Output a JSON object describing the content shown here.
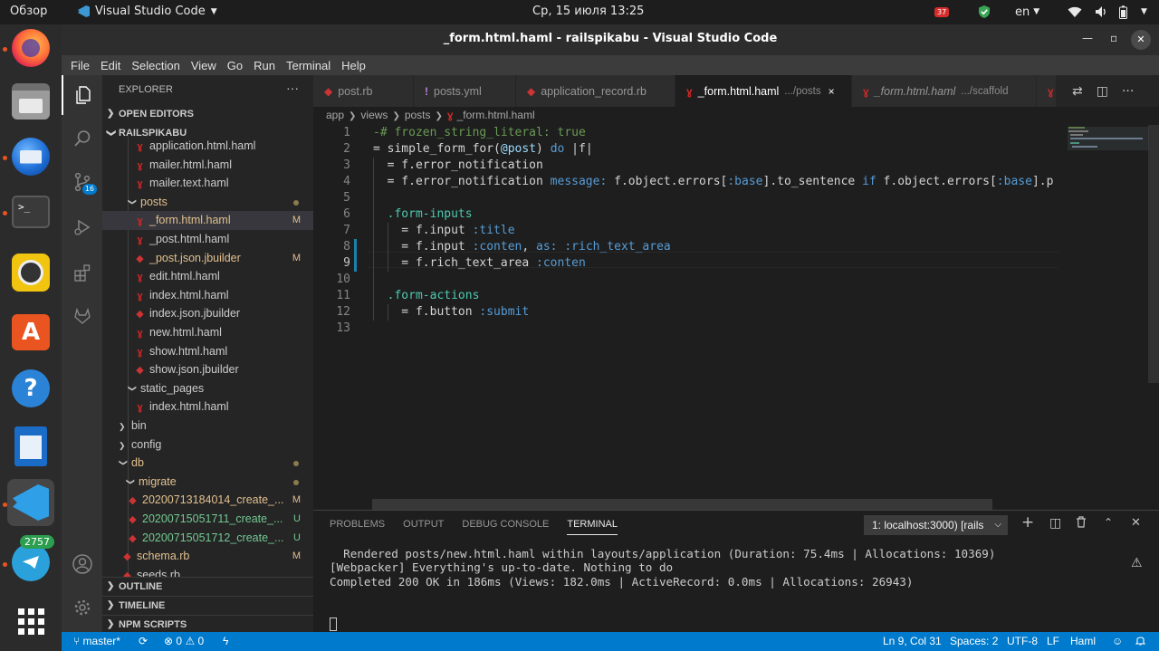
{
  "system_bar": {
    "activities": "Обзор",
    "app_name": "Visual Studio Code",
    "datetime": "Ср, 15 июля  13:25",
    "notification_count": "37",
    "keyboard_layout": "en"
  },
  "dock": {
    "telegram_badge": "2757",
    "apps": [
      "firefox-icon",
      "files-icon",
      "thunderbird-icon",
      "terminal-icon",
      "rhythmbox-icon",
      "software-center-icon",
      "help-icon",
      "libreoffice-writer-icon",
      "vscode-icon",
      "telegram-icon",
      "show-apps-icon"
    ]
  },
  "window": {
    "title": "_form.html.haml - railspikabu - Visual Studio Code"
  },
  "menu": [
    "File",
    "Edit",
    "Selection",
    "View",
    "Go",
    "Run",
    "Terminal",
    "Help"
  ],
  "activity": {
    "scm_badge": "16"
  },
  "explorer": {
    "header": "EXPLORER",
    "more": "···",
    "open_editors": "OPEN EDITORS",
    "project": "RAILSPIKABU",
    "tree": [
      {
        "name": "application.html.haml",
        "icon": "haml",
        "status": ""
      },
      {
        "name": "mailer.html.haml",
        "icon": "haml",
        "status": ""
      },
      {
        "name": "mailer.text.haml",
        "icon": "haml",
        "status": ""
      },
      {
        "name": "posts",
        "icon": "folder",
        "status": "dot"
      },
      {
        "name": "_form.html.haml",
        "icon": "haml",
        "status": "M"
      },
      {
        "name": "_post.html.haml",
        "icon": "haml",
        "status": ""
      },
      {
        "name": "_post.json.jbuilder",
        "icon": "rb",
        "status": "M"
      },
      {
        "name": "edit.html.haml",
        "icon": "haml",
        "status": ""
      },
      {
        "name": "index.html.haml",
        "icon": "haml",
        "status": ""
      },
      {
        "name": "index.json.jbuilder",
        "icon": "rb",
        "status": ""
      },
      {
        "name": "new.html.haml",
        "icon": "haml",
        "status": ""
      },
      {
        "name": "show.html.haml",
        "icon": "haml",
        "status": ""
      },
      {
        "name": "show.json.jbuilder",
        "icon": "rb",
        "status": ""
      },
      {
        "name": "static_pages",
        "icon": "folder",
        "status": ""
      },
      {
        "name": "index.html.haml",
        "icon": "haml",
        "status": ""
      },
      {
        "name": "bin",
        "icon": "folder-closed",
        "status": ""
      },
      {
        "name": "config",
        "icon": "folder-closed",
        "status": ""
      },
      {
        "name": "db",
        "icon": "folder",
        "status": "dot"
      },
      {
        "name": "migrate",
        "icon": "folder",
        "status": "dot"
      },
      {
        "name": "20200713184014_create_...",
        "icon": "rb",
        "status": "M"
      },
      {
        "name": "20200715051711_create_...",
        "icon": "rb",
        "status": "U"
      },
      {
        "name": "20200715051712_create_...",
        "icon": "rb",
        "status": "U"
      },
      {
        "name": "schema.rb",
        "icon": "rb",
        "status": "M"
      },
      {
        "name": "seeds.rb",
        "icon": "rb",
        "status": ""
      }
    ],
    "outline": "OUTLINE",
    "timeline": "TIMELINE",
    "npm_scripts": "NPM SCRIPTS"
  },
  "tabs": [
    {
      "icon": "rb",
      "name": "post.rb",
      "desc": ""
    },
    {
      "icon": "yml",
      "name": "posts.yml",
      "desc": ""
    },
    {
      "icon": "rb",
      "name": "application_record.rb",
      "desc": ""
    },
    {
      "icon": "haml",
      "name": "_form.html.haml",
      "desc": ".../posts"
    },
    {
      "icon": "haml",
      "name": "_form.html.haml",
      "desc": ".../scaffold"
    }
  ],
  "tab_close": "×",
  "breadcrumb": [
    "app",
    "views",
    "posts",
    "_form.html.haml"
  ],
  "code_line_numbers": [
    "1",
    "2",
    "3",
    "4",
    "5",
    "6",
    "7",
    "8",
    "9",
    "10",
    "11",
    "12",
    "13"
  ],
  "panel": {
    "tabs": [
      "PROBLEMS",
      "OUTPUT",
      "DEBUG CONSOLE",
      "TERMINAL"
    ],
    "terminal_select": "1: localhost:3000) [rails",
    "terminal_lines": [
      "  Rendered posts/new.html.haml within layouts/application (Duration: 75.4ms | Allocations: 10369)",
      "[Webpacker] Everything's up-to-date. Nothing to do",
      "Completed 200 OK in 186ms (Views: 182.0ms | ActiveRecord: 0.0ms | Allocations: 26943)"
    ]
  },
  "status_bar": {
    "branch": "master*",
    "errors": "0",
    "warnings": "0",
    "cursor": "Ln 9, Col 31",
    "spaces": "Spaces: 2",
    "encoding": "UTF-8",
    "eol": "LF",
    "language": "Haml"
  },
  "colors": {
    "statusbar": "#007acc",
    "editor_bg": "#1e1e1e",
    "sidebar_bg": "#252526",
    "modified": "#e2c08d",
    "untracked": "#73c991"
  }
}
